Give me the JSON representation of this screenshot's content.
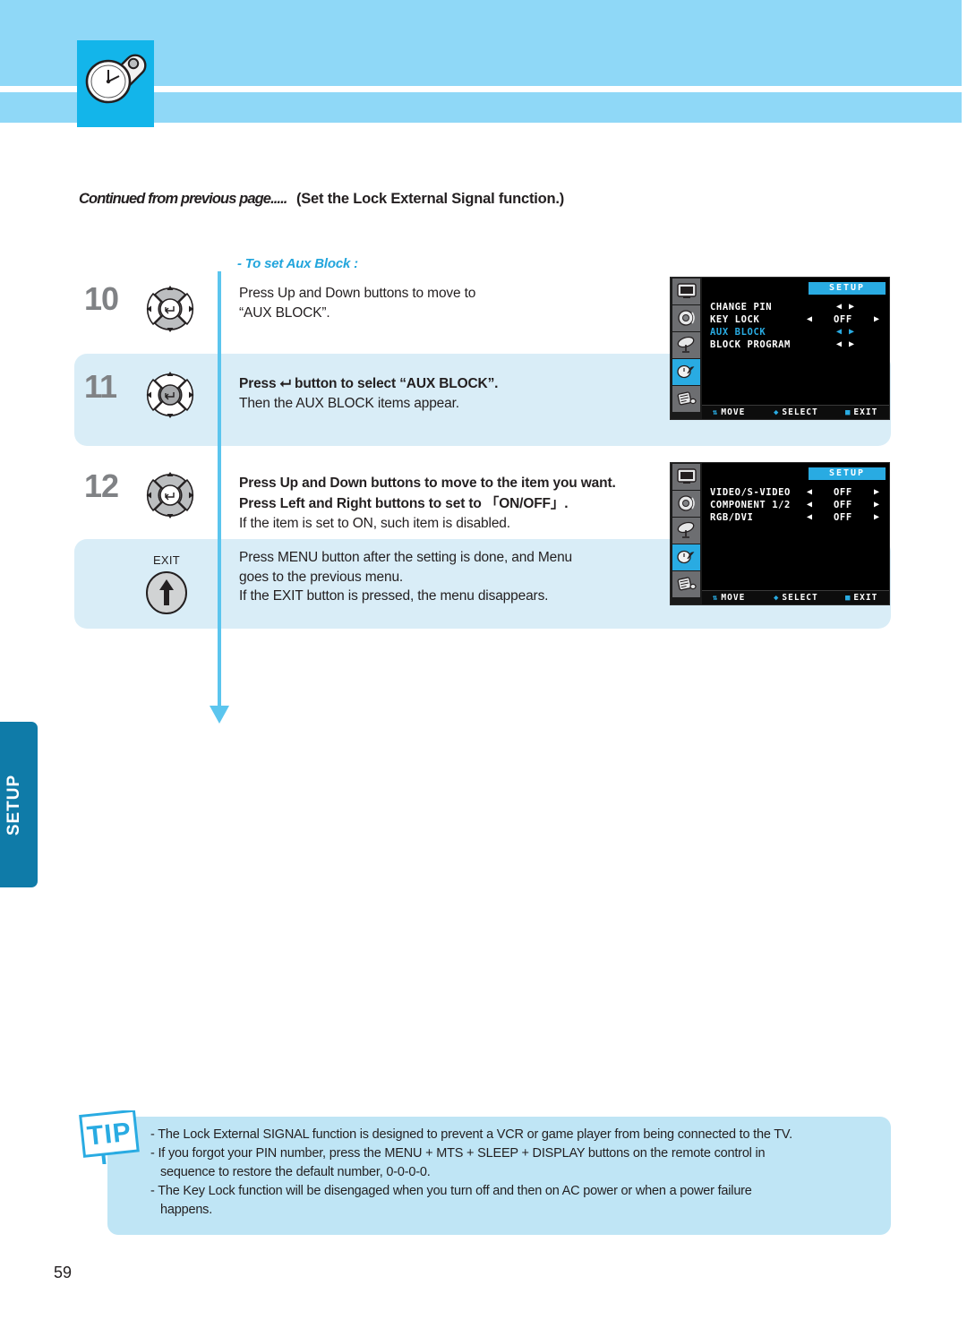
{
  "header": {
    "icon": "clock-wrench-icon",
    "band_color": "#8fd8f7",
    "tile_color": "#13b5ea"
  },
  "title": {
    "continued": "Continued from previous page.....",
    "main": "(Set the Lock External Signal function.)"
  },
  "subtitle": "- To set Aux Block :",
  "accent_color": "#22a5dc",
  "steps": [
    {
      "number": "10",
      "control": "nav-wheel-updown",
      "lines": [
        {
          "text": "Press Up and Down buttons to move to",
          "bold": false
        },
        {
          "text": "“AUX BLOCK”.",
          "bold": false
        }
      ]
    },
    {
      "number": "11",
      "control": "nav-wheel-enter",
      "lines": [
        {
          "text": "Press ⮠ button to select “AUX BLOCK”.",
          "bold": true
        },
        {
          "text": "Then the AUX BLOCK items appear.",
          "bold": false
        }
      ]
    },
    {
      "number": "12",
      "control": "nav-wheel-all",
      "lines": [
        {
          "text": "Press Up and Down buttons to move to the item you want.",
          "bold": true
        },
        {
          "text": "Press Left and Right buttons to set to 「ON/OFF」.",
          "bold": true
        },
        {
          "text": "If the item is set to ON, such item is disabled.",
          "bold": false
        }
      ]
    },
    {
      "number": "",
      "control": "exit-button",
      "exit_label": "EXIT",
      "lines": [
        {
          "text": "Press MENU button after the setting is done, and Menu",
          "bold": false
        },
        {
          "text": "goes to the previous menu.",
          "bold": false
        },
        {
          "text": "If the EXIT button is pressed, the menu disappears.",
          "bold": false
        }
      ]
    }
  ],
  "osd_screens": [
    {
      "title": "SETUP",
      "sidebar_icons": [
        "picture-icon",
        "sound-icon",
        "antenna-icon",
        "setup-icon",
        "special-icon"
      ],
      "active_icon_index": 3,
      "items": [
        {
          "label": "CHANGE PIN",
          "value": "",
          "highlighted": false,
          "left_arrow": true,
          "right_arrow": true,
          "spread": false
        },
        {
          "label": "KEY LOCK",
          "value": "OFF",
          "highlighted": false,
          "left_arrow": true,
          "right_arrow": true,
          "spread": true
        },
        {
          "label": "AUX BLOCK",
          "value": "",
          "highlighted": true,
          "left_arrow": true,
          "right_arrow": true,
          "spread": false
        },
        {
          "label": "BLOCK PROGRAM",
          "value": "",
          "highlighted": false,
          "left_arrow": true,
          "right_arrow": true,
          "spread": false
        }
      ],
      "footer": [
        {
          "icon": "updown-icon",
          "label": "MOVE"
        },
        {
          "icon": "leftright-icon",
          "label": "SELECT"
        },
        {
          "icon": "menu-icon",
          "label": "EXIT"
        }
      ]
    },
    {
      "title": "SETUP",
      "sidebar_icons": [
        "picture-icon",
        "sound-icon",
        "antenna-icon",
        "setup-icon",
        "special-icon"
      ],
      "active_icon_index": 3,
      "items": [
        {
          "label": "VIDEO/S-VIDEO",
          "value": "OFF",
          "highlighted": false,
          "left_arrow": true,
          "right_arrow": true,
          "spread": true
        },
        {
          "label": "COMPONENT 1/2",
          "value": "OFF",
          "highlighted": false,
          "left_arrow": true,
          "right_arrow": true,
          "spread": true
        },
        {
          "label": "RGB/DVI",
          "value": "OFF",
          "highlighted": false,
          "left_arrow": true,
          "right_arrow": true,
          "spread": true
        }
      ],
      "footer": [
        {
          "icon": "updown-icon",
          "label": "MOVE"
        },
        {
          "icon": "leftright-icon",
          "label": "SELECT"
        },
        {
          "icon": "menu-icon",
          "label": "EXIT"
        }
      ]
    }
  ],
  "side_tab": {
    "label": "SETUP",
    "color": "#0f7ba8"
  },
  "tip": {
    "badge": "TIP",
    "lines": [
      {
        "text": "- The Lock External SIGNAL function is designed to prevent a VCR or game player from being connected to the TV.",
        "indent": false
      },
      {
        "text": "- If you forgot your PIN number, press the MENU + MTS + SLEEP + DISPLAY buttons on the remote control in",
        "indent": false
      },
      {
        "text": "sequence to restore the default number, 0-0-0-0.",
        "indent": true
      },
      {
        "text": "- The Key Lock function will be disengaged when you turn off and then on AC power or when a power failure",
        "indent": false
      },
      {
        "text": "happens.",
        "indent": true
      }
    ]
  },
  "page_number": "59"
}
